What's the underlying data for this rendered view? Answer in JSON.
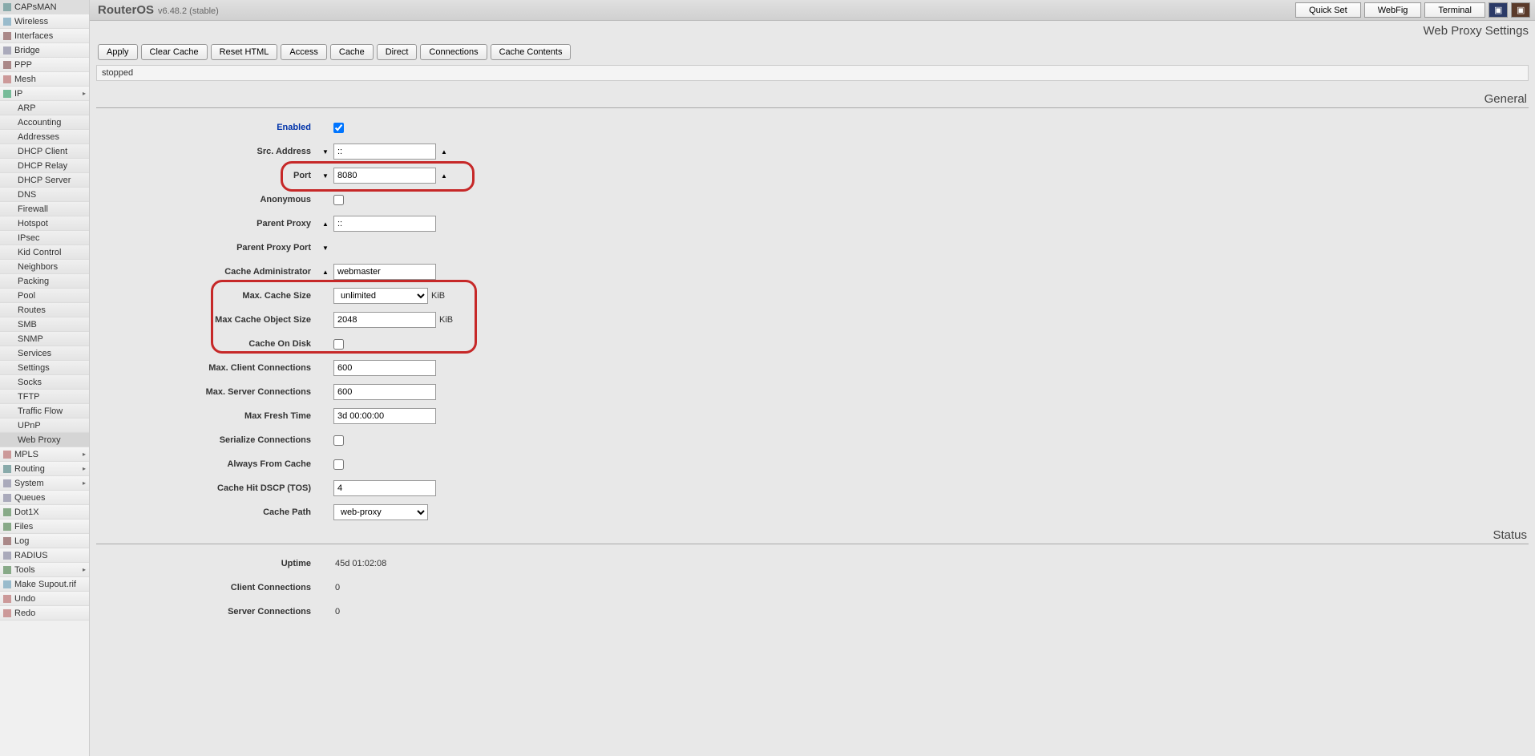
{
  "brand": {
    "name": "RouterOS",
    "version": "v6.48.2 (stable)"
  },
  "top_buttons": {
    "quick_set": "Quick Set",
    "webfig": "WebFig",
    "terminal": "Terminal"
  },
  "page_title": "Web Proxy Settings",
  "toolbar": {
    "apply": "Apply",
    "clear_cache": "Clear Cache",
    "reset_html": "Reset HTML",
    "access": "Access",
    "cache": "Cache",
    "direct": "Direct",
    "connections": "Connections",
    "cache_contents": "Cache Contents"
  },
  "status_strip": "stopped",
  "sections": {
    "general": "General",
    "status": "Status"
  },
  "nav": {
    "main": [
      "CAPsMAN",
      "Wireless",
      "Interfaces",
      "Bridge",
      "PPP",
      "Mesh",
      "IP"
    ],
    "ip_sub": [
      "ARP",
      "Accounting",
      "Addresses",
      "DHCP Client",
      "DHCP Relay",
      "DHCP Server",
      "DNS",
      "Firewall",
      "Hotspot",
      "IPsec",
      "Kid Control",
      "Neighbors",
      "Packing",
      "Pool",
      "Routes",
      "SMB",
      "SNMP",
      "Services",
      "Settings",
      "Socks",
      "TFTP",
      "Traffic Flow",
      "UPnP",
      "Web Proxy"
    ],
    "after": [
      "MPLS",
      "Routing",
      "System",
      "Queues",
      "Dot1X",
      "Files",
      "Log",
      "RADIUS",
      "Tools",
      "Make Supout.rif",
      "Undo",
      "Redo"
    ]
  },
  "nav_expand": {
    "IP": true,
    "MPLS": true,
    "Routing": true,
    "System": true,
    "Tools": true
  },
  "form": {
    "enabled": {
      "label": "Enabled",
      "checked": true
    },
    "src_address": {
      "label": "Src. Address",
      "value": "::"
    },
    "port": {
      "label": "Port",
      "value": "8080"
    },
    "anonymous": {
      "label": "Anonymous",
      "checked": false
    },
    "parent_proxy": {
      "label": "Parent Proxy",
      "value": "::"
    },
    "parent_proxy_port": {
      "label": "Parent Proxy Port",
      "value": ""
    },
    "cache_admin": {
      "label": "Cache Administrator",
      "value": "webmaster"
    },
    "max_cache_size": {
      "label": "Max. Cache Size",
      "value": "unlimited",
      "unit": "KiB"
    },
    "max_cache_obj_size": {
      "label": "Max Cache Object Size",
      "value": "2048",
      "unit": "KiB"
    },
    "cache_on_disk": {
      "label": "Cache On Disk",
      "checked": false
    },
    "max_client_conn": {
      "label": "Max. Client Connections",
      "value": "600"
    },
    "max_server_conn": {
      "label": "Max. Server Connections",
      "value": "600"
    },
    "max_fresh_time": {
      "label": "Max Fresh Time",
      "value": "3d 00:00:00"
    },
    "serialize_conn": {
      "label": "Serialize Connections",
      "checked": false
    },
    "always_from_cache": {
      "label": "Always From Cache",
      "checked": false
    },
    "cache_hit_dscp": {
      "label": "Cache Hit DSCP (TOS)",
      "value": "4"
    },
    "cache_path": {
      "label": "Cache Path",
      "value": "web-proxy"
    }
  },
  "status": {
    "uptime": {
      "label": "Uptime",
      "value": "45d 01:02:08"
    },
    "client_conn": {
      "label": "Client Connections",
      "value": "0"
    },
    "server_conn": {
      "label": "Server Connections",
      "value": "0"
    }
  }
}
